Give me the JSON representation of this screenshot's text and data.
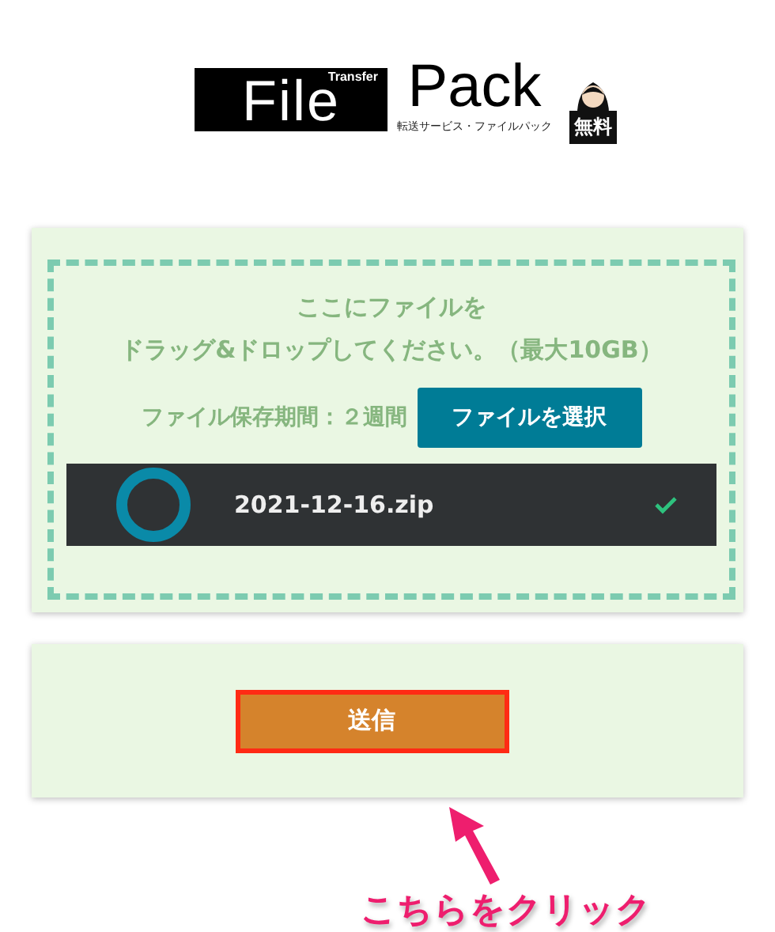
{
  "logo": {
    "word": "File",
    "superscript": "Transfer",
    "second_word": "Pack",
    "tagline": "転送サービス・ファイルパック",
    "badge": "無料"
  },
  "drop_zone": {
    "message_lines": [
      "ここにファイルを",
      "ドラッグ&ドロップしてください。（最大10GB）"
    ],
    "retention": "ファイル保存期間：２週間",
    "select_button": "ファイルを選択"
  },
  "files": [
    {
      "name": "2021-12-16.zip",
      "uploaded": true
    }
  ],
  "send_button": {
    "label": "送信",
    "highlighted": true
  },
  "annotation": {
    "text": "こちらをクリック"
  }
}
